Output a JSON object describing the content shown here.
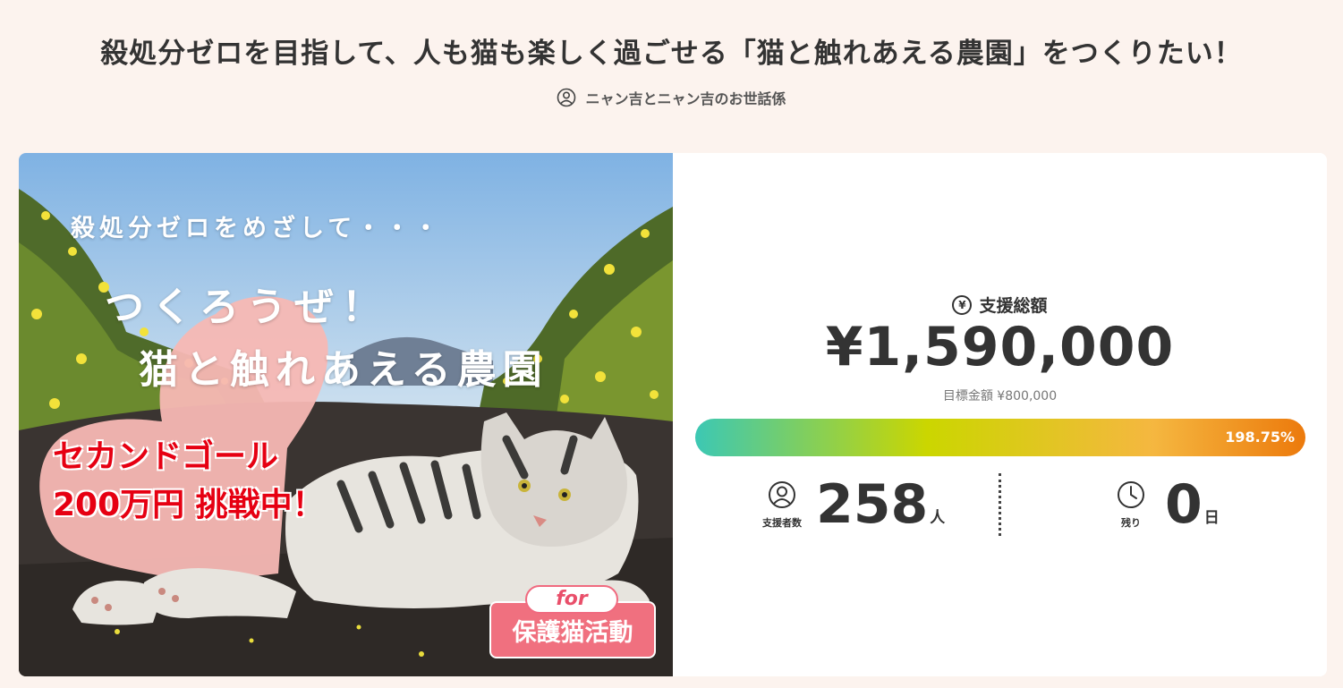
{
  "page": {
    "title": "殺処分ゼロを目指して、人も猫も楽しく過ごせる「猫と触れあえる農園」をつくりたい！",
    "owner": {
      "icon": "user-icon",
      "name": "ニャン吉とニャン吉のお世話係"
    }
  },
  "hero": {
    "line1": "殺処分ゼロをめざして・・・",
    "line2": "つくろうぜ！",
    "line3": "猫と触れあえる農園",
    "red_line1": "セカンドゴール",
    "red_line2": "200万円 挑戦中！",
    "badge_for": "for",
    "badge_main": "保護猫活動",
    "colors": {
      "heart": "#f7b8b4",
      "red": "#e60012",
      "badge": "#f0707f"
    }
  },
  "stats": {
    "total_label": "支援総額",
    "total_icon": "yen-icon",
    "total_amount": "¥1,590,000",
    "goal_text": "目標金額 ¥800,000",
    "progress_percent": 198.75,
    "progress_label": "198.75%",
    "supporters": {
      "icon": "person-icon",
      "caption": "支援者数",
      "value": "258",
      "unit": "人"
    },
    "remaining": {
      "icon": "clock-icon",
      "caption": "残り",
      "value": "0",
      "unit": "日"
    }
  }
}
